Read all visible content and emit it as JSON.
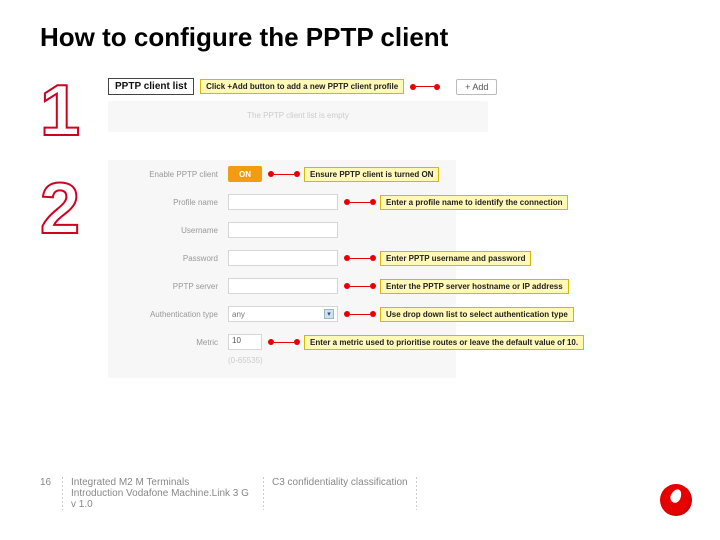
{
  "title": "How to configure the PPTP client",
  "step_numbers": {
    "one": "1",
    "two": "2"
  },
  "section1": {
    "panel_title": "PPTP client list",
    "callout": "Click +Add button to add a new PPTP client profile",
    "add_button": "+  Add",
    "empty_text": "The PPTP client list is empty"
  },
  "section2": {
    "rows": {
      "enable": {
        "label": "Enable PPTP client",
        "toggle_value": "ON",
        "callout": "Ensure PPTP client is turned ON"
      },
      "profile": {
        "label": "Profile name",
        "callout": "Enter a profile name to identify the connection"
      },
      "username": {
        "label": "Username"
      },
      "password": {
        "label": "Password",
        "callout": "Enter PPTP username and password"
      },
      "server": {
        "label": "PPTP server",
        "callout": "Enter the PPTP server hostname or IP address"
      },
      "auth": {
        "label": "Authentication type",
        "selected": "any",
        "callout": "Use drop down list to select authentication type"
      },
      "metric": {
        "label": "Metric",
        "value": "10",
        "callout": "Enter a metric used to prioritise routes or leave the default value of 10."
      },
      "range_hint": "(0-65535)"
    }
  },
  "footer": {
    "page": "16",
    "col1_line1": "Integrated M2 M Terminals",
    "col1_line2": "Introduction Vodafone Machine.Link 3 G v 1.0",
    "col2": "C3 confidentiality classification"
  }
}
